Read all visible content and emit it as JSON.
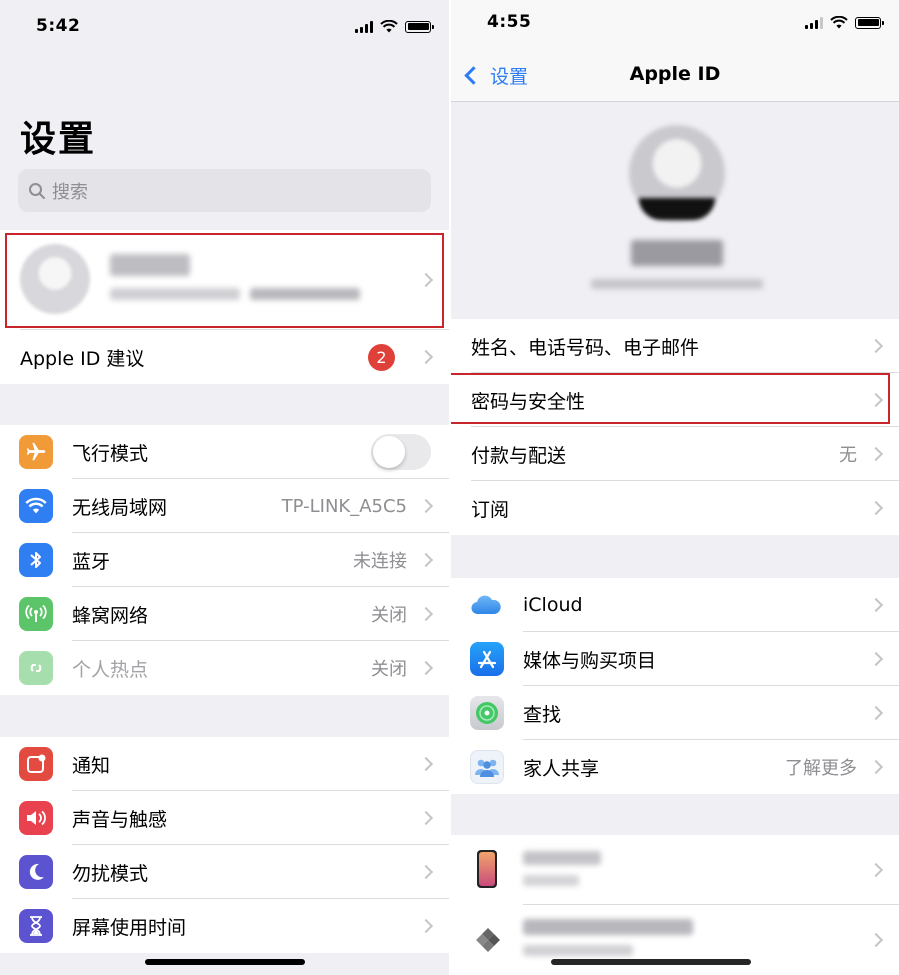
{
  "left": {
    "status_time": "5:42",
    "title": "设置",
    "search_placeholder": "搜索",
    "apple_id_suggestions": {
      "label": "Apple ID 建议",
      "badge": "2"
    },
    "connectivity": [
      {
        "id": "airplane",
        "label": "飞行模式",
        "value": "",
        "icon": "airplane-icon",
        "color": "#f19a38",
        "toggle": false
      },
      {
        "id": "wifi",
        "label": "无线局域网",
        "value": "TP-LINK_A5C5",
        "icon": "wifi-icon",
        "color": "#2f7ff2"
      },
      {
        "id": "bluetooth",
        "label": "蓝牙",
        "value": "未连接",
        "icon": "bluetooth-icon",
        "color": "#2f7ff2"
      },
      {
        "id": "cellular",
        "label": "蜂窝网络",
        "value": "关闭",
        "icon": "antenna-icon",
        "color": "#5cc469"
      },
      {
        "id": "hotspot",
        "label": "个人热点",
        "value": "关闭",
        "icon": "hotspot-icon",
        "color": "#a6dfad",
        "disabled": true
      }
    ],
    "system": [
      {
        "id": "notifications",
        "label": "通知",
        "icon": "notification-icon",
        "color": "#e34a40"
      },
      {
        "id": "sounds",
        "label": "声音与触感",
        "icon": "speaker-icon",
        "color": "#e8424f"
      },
      {
        "id": "dnd",
        "label": "勿扰模式",
        "icon": "moon-icon",
        "color": "#5b53cf"
      },
      {
        "id": "screentime",
        "label": "屏幕使用时间",
        "icon": "hourglass-icon",
        "color": "#5b53cf"
      }
    ]
  },
  "right": {
    "status_time": "4:55",
    "back_label": "设置",
    "title": "Apple ID",
    "account": [
      {
        "id": "name",
        "label": "姓名、电话号码、电子邮件",
        "value": ""
      },
      {
        "id": "password",
        "label": "密码与安全性",
        "value": ""
      },
      {
        "id": "payment",
        "label": "付款与配送",
        "value": "无"
      },
      {
        "id": "subscriptions",
        "label": "订阅",
        "value": ""
      }
    ],
    "services": [
      {
        "id": "icloud",
        "label": "iCloud",
        "value": "",
        "icon": "cloud-icon"
      },
      {
        "id": "media",
        "label": "媒体与购买项目",
        "value": "",
        "icon": "app-store-icon"
      },
      {
        "id": "findmy",
        "label": "查找",
        "value": "",
        "icon": "find-my-icon"
      },
      {
        "id": "family",
        "label": "家人共享",
        "value": "了解更多",
        "icon": "family-icon"
      }
    ]
  }
}
